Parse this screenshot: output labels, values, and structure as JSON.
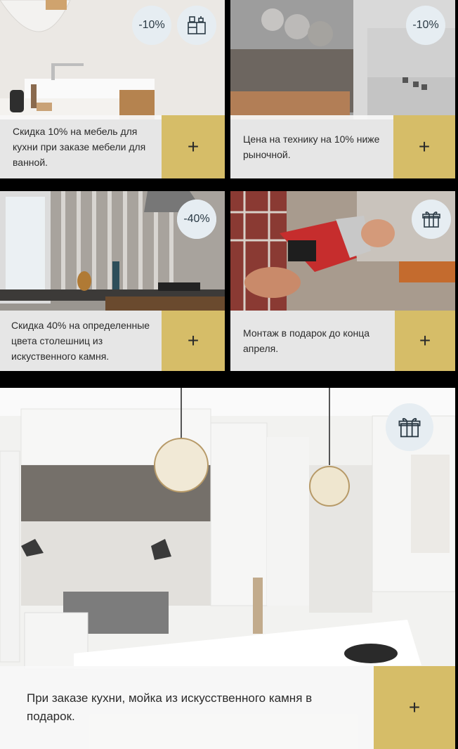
{
  "cards": [
    {
      "text": "Скидка 10% на мебель для кухни при заказе мебели для ванной.",
      "badge": "-10%",
      "icon": "kitchen-cabinet-icon",
      "button": "+"
    },
    {
      "text": "Цена на технику на 10% ниже рыночной.",
      "badge": "-10%",
      "button": "+"
    },
    {
      "text": "Скидка 40% на определенные цвета столешниц из искуственного камня.",
      "badge": "-40%",
      "button": "+"
    },
    {
      "text": "Монтаж в подарок до конца апреля.",
      "icon": "gift-icon",
      "button": "+"
    },
    {
      "text": "При заказе кухни, мойка из искусственного камня в подарок.",
      "icon": "gift-icon",
      "button": "+"
    }
  ],
  "colors": {
    "accent": "#d6bd68",
    "badge_bg": "#e6edf2",
    "caption_bg": "#f7f7f7"
  }
}
